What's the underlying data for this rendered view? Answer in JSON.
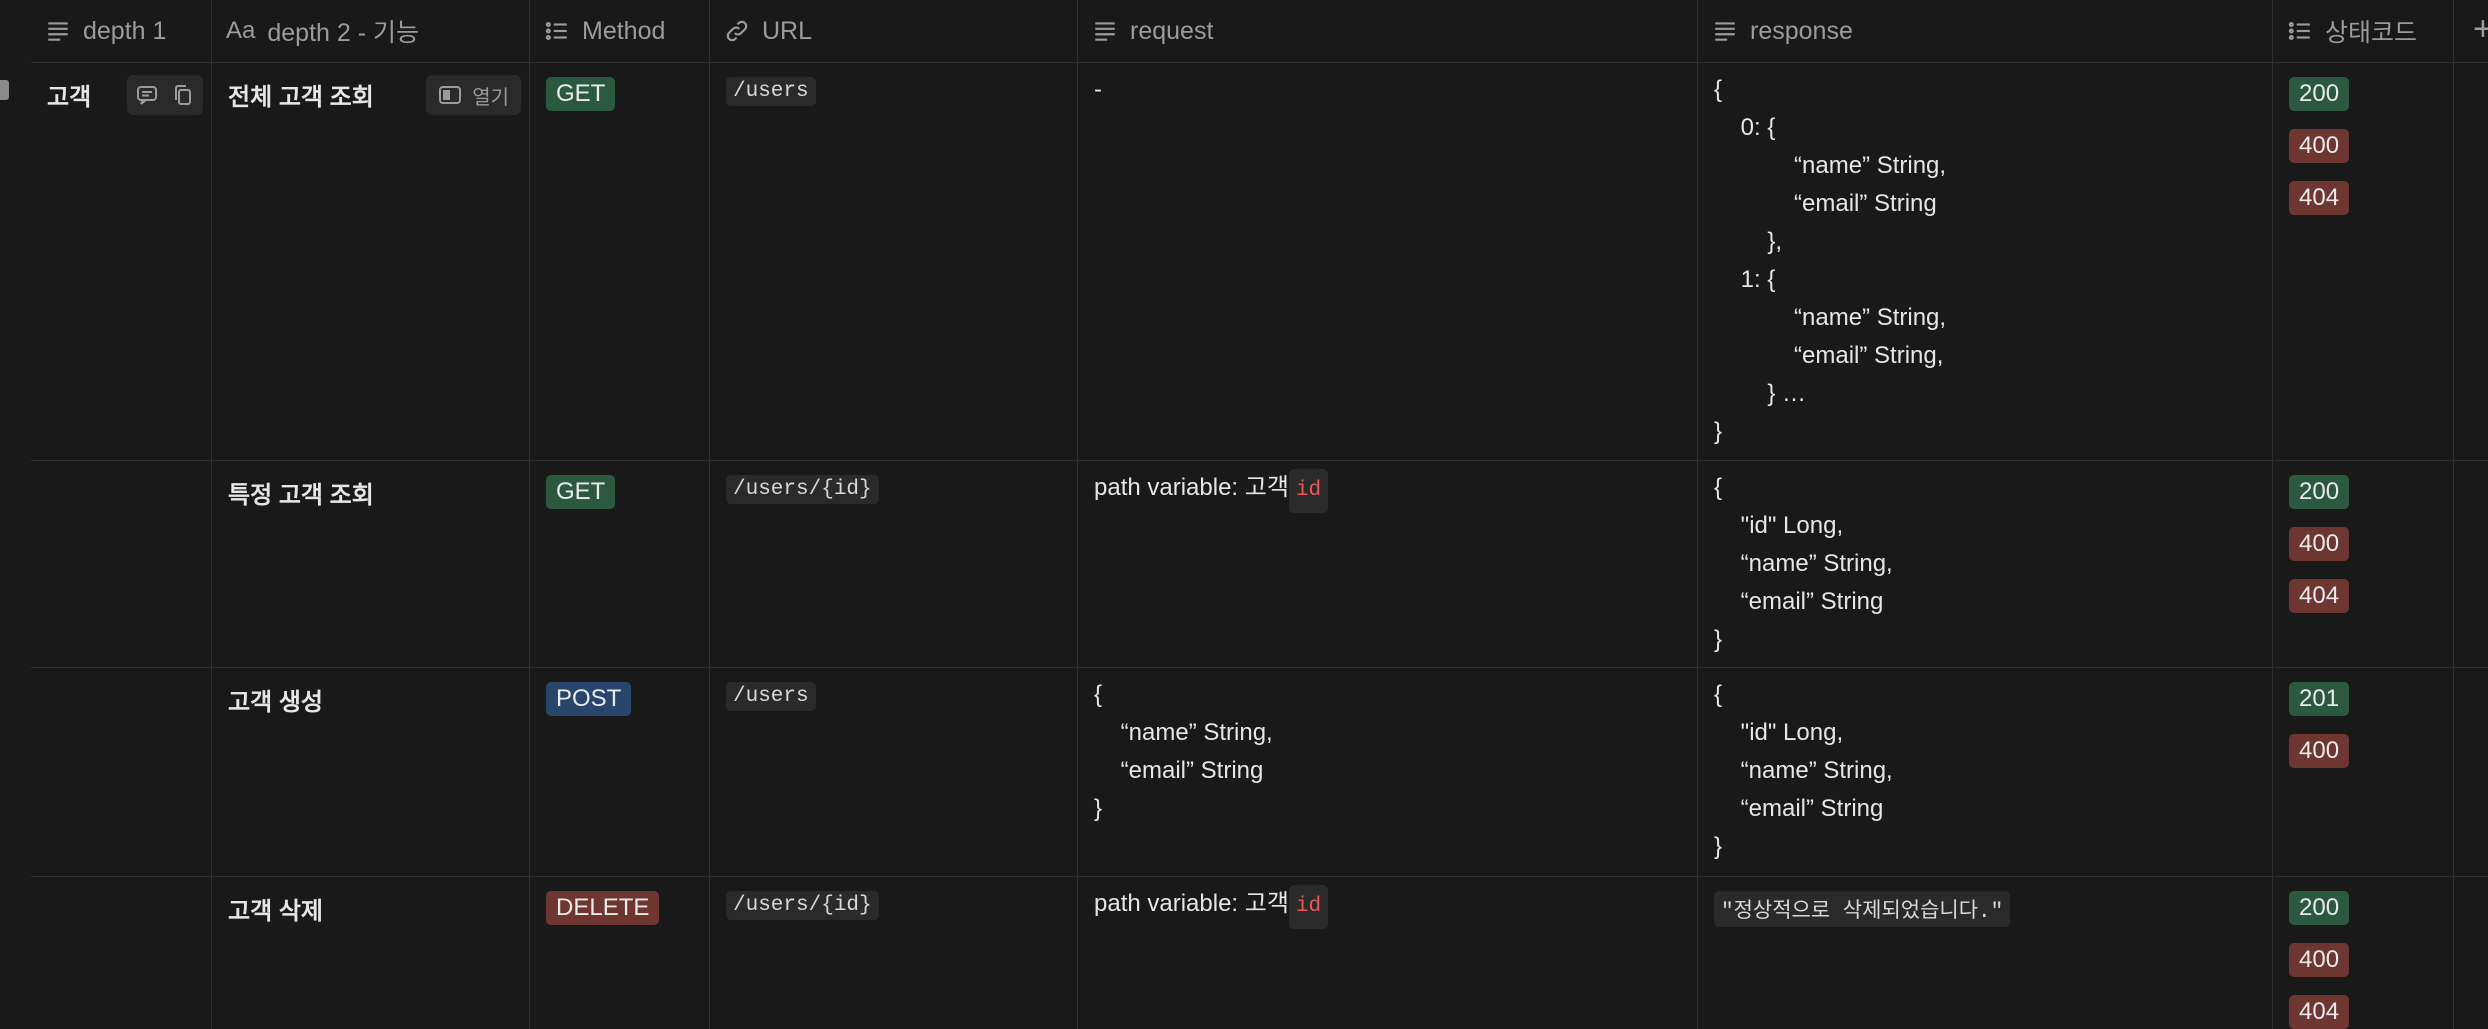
{
  "columns": [
    {
      "label": "depth 1",
      "icon": "text-lines-icon"
    },
    {
      "label": "depth 2 - 기능",
      "icon": "title-aa-icon"
    },
    {
      "label": "Method",
      "icon": "multi-select-icon"
    },
    {
      "label": "URL",
      "icon": "link-icon"
    },
    {
      "label": "request",
      "icon": "text-lines-icon"
    },
    {
      "label": "response",
      "icon": "text-lines-icon"
    },
    {
      "label": "상태코드",
      "icon": "multi-select-icon"
    }
  ],
  "add_column_symbol": "+",
  "hover_actions": {
    "open_label": "열기"
  },
  "rows": [
    {
      "depth1": "고객",
      "feature": "전체 고객 조회",
      "method": "GET",
      "url": "/users",
      "request_text": "-",
      "response_lines": [
        "{",
        "    0: {",
        "            “name” String,",
        "            “email” String",
        "        },",
        "    1: {",
        "            “name” String,",
        "            “email” String,",
        "        } …",
        "}"
      ],
      "status": [
        "200",
        "400",
        "404"
      ]
    },
    {
      "depth1": "",
      "feature": "특정 고객 조회",
      "method": "GET",
      "url": "/users/{id}",
      "request_prefix": "path variable: 고객",
      "request_code": "id",
      "response_lines": [
        "{",
        "    \"id\" Long,",
        "    “name” String,",
        "    “email” String",
        "}"
      ],
      "status": [
        "200",
        "400",
        "404"
      ]
    },
    {
      "depth1": "",
      "feature": "고객 생성",
      "method": "POST",
      "url": "/users",
      "request_lines": [
        "{",
        "    “name” String,",
        "    “email” String",
        "}"
      ],
      "response_lines": [
        "{",
        "    \"id\" Long,",
        "    “name” String,",
        "    “email” String",
        "}"
      ],
      "status": [
        "201",
        "400"
      ]
    },
    {
      "depth1": "",
      "feature": "고객 삭제",
      "method": "DELETE",
      "url": "/users/{id}",
      "request_prefix": "path variable: 고객",
      "request_code": "id",
      "response_code": "\"정상적으로 삭제되었습니다.\"",
      "status": [
        "200",
        "400",
        "404"
      ]
    }
  ],
  "colors": {
    "background": "#191919",
    "tag_green": "#2b593f",
    "tag_blue": "#28456c",
    "tag_red": "#6e3630",
    "inline_code_red": "#eb5757"
  }
}
